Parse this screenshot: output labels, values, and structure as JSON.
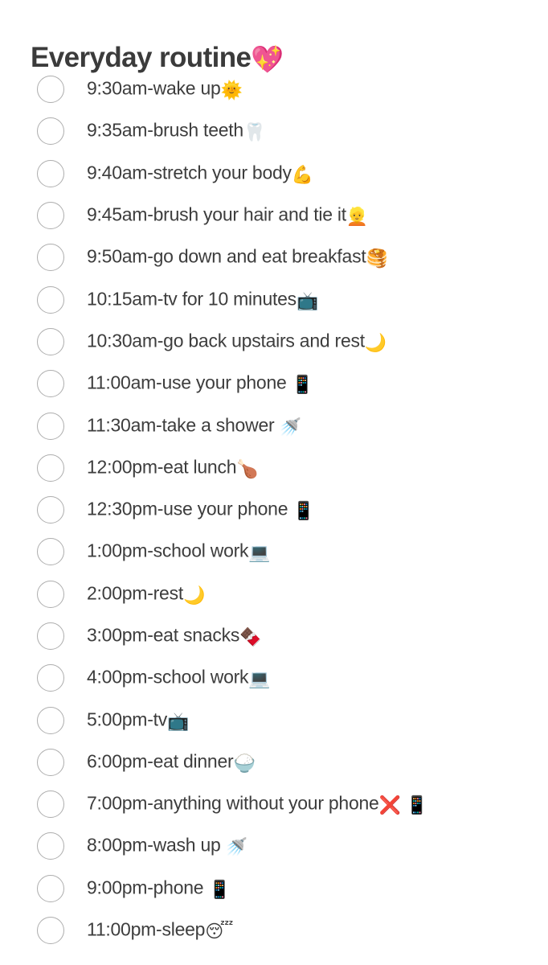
{
  "note": {
    "title_text": "Everyday routine",
    "title_emoji": "💖",
    "title_emoji_name": "sparkling-heart-emoji",
    "background_color": "#ffffff",
    "text_color": "#3d3d3d",
    "title_color": "#3b3b3b",
    "checkbox_border_color": "#adadad",
    "checkbox_state": "unchecked"
  },
  "checklist": {
    "item_count": 21,
    "items": [
      {
        "text": "9:30am-wake up",
        "emoji": "🌞",
        "emoji_name": "sun-with-face-emoji"
      },
      {
        "text": "9:35am-brush teeth",
        "emoji": "🦷",
        "emoji_name": "tooth-emoji"
      },
      {
        "text": "9:40am-stretch your body",
        "emoji": "💪",
        "emoji_name": "flexed-biceps-emoji"
      },
      {
        "text": "9:45am-brush your hair and tie it",
        "emoji": "👱",
        "emoji_name": "blond-haired-person-emoji"
      },
      {
        "text": "9:50am-go down and eat breakfast",
        "emoji": "🥞",
        "emoji_name": "pancakes-emoji"
      },
      {
        "text": "10:15am-tv for 10 minutes",
        "emoji": "📺",
        "emoji_name": "television-emoji"
      },
      {
        "text": "10:30am-go back upstairs and rest",
        "emoji": "🌙",
        "emoji_name": "crescent-moon-emoji"
      },
      {
        "text": "11:00am-use your phone ",
        "emoji": "📱",
        "emoji_name": "mobile-phone-emoji"
      },
      {
        "text": "11:30am-take a shower ",
        "emoji": "🚿",
        "emoji_name": "shower-emoji"
      },
      {
        "text": "12:00pm-eat lunch",
        "emoji": "🍗",
        "emoji_name": "poultry-leg-emoji"
      },
      {
        "text": "12:30pm-use your phone ",
        "emoji": "📱",
        "emoji_name": "mobile-phone-emoji"
      },
      {
        "text": "1:00pm-school work",
        "emoji": "💻",
        "emoji_name": "laptop-emoji"
      },
      {
        "text": "2:00pm-rest",
        "emoji": "🌙",
        "emoji_name": "crescent-moon-emoji"
      },
      {
        "text": "3:00pm-eat snacks",
        "emoji": "🍫",
        "emoji_name": "chocolate-bar-emoji"
      },
      {
        "text": "4:00pm-school work",
        "emoji": "💻",
        "emoji_name": "laptop-emoji"
      },
      {
        "text": "5:00pm-tv",
        "emoji": "📺",
        "emoji_name": "television-emoji"
      },
      {
        "text": "6:00pm-eat dinner",
        "emoji": "🍚",
        "emoji_name": "cooked-rice-emoji"
      },
      {
        "text": "7:00pm-anything without your phone",
        "emoji": "❌ 📱",
        "emoji_name": "cross-mark-and-mobile-phone-emoji"
      },
      {
        "text": "8:00pm-wash up ",
        "emoji": "🚿",
        "emoji_name": "shower-emoji"
      },
      {
        "text": "9:00pm-phone ",
        "emoji": "📱",
        "emoji_name": "mobile-phone-emoji"
      },
      {
        "text": "11:00pm-sleep",
        "emoji": "😴",
        "emoji_name": "sleeping-face-emoji"
      }
    ]
  }
}
